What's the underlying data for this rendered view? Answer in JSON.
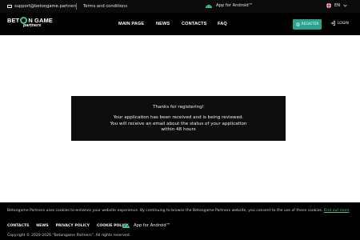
{
  "topbar": {
    "email": "support@betongame.partners",
    "terms": "Terms and conditions",
    "android_app": "App for Android™",
    "language": "EN"
  },
  "header": {
    "logo_line1_pre": "BET",
    "logo_line1_post": "N GAME",
    "logo_line2": "partners",
    "nav": [
      "MAIN PAGE",
      "NEWS",
      "CONTACTS",
      "FAQ"
    ],
    "register": "REGISTER",
    "login": "LOGIN"
  },
  "modal": {
    "title": "Thanks for registering!",
    "message": "Your application has been received and is being reviewed. You will receive an email about the status of your application within 48 hours"
  },
  "footer": {
    "cookie_text": "Betongame Partners uses cookies to enhance your website experience. By continuing to browse the Betongame Partners website, you consent to the use of these cookies.",
    "cookie_link": "Find out more",
    "links": [
      "CONTACTS",
      "NEWS",
      "PRIVACY POLICY",
      "COOKIE POLICY"
    ],
    "android_app": "App for Android™",
    "copyright": "Copyright © 2020-2026 \"Betongame Partners\". All rights reserved."
  },
  "colors": {
    "accent": "#2aa38c",
    "dark": "#000000"
  }
}
